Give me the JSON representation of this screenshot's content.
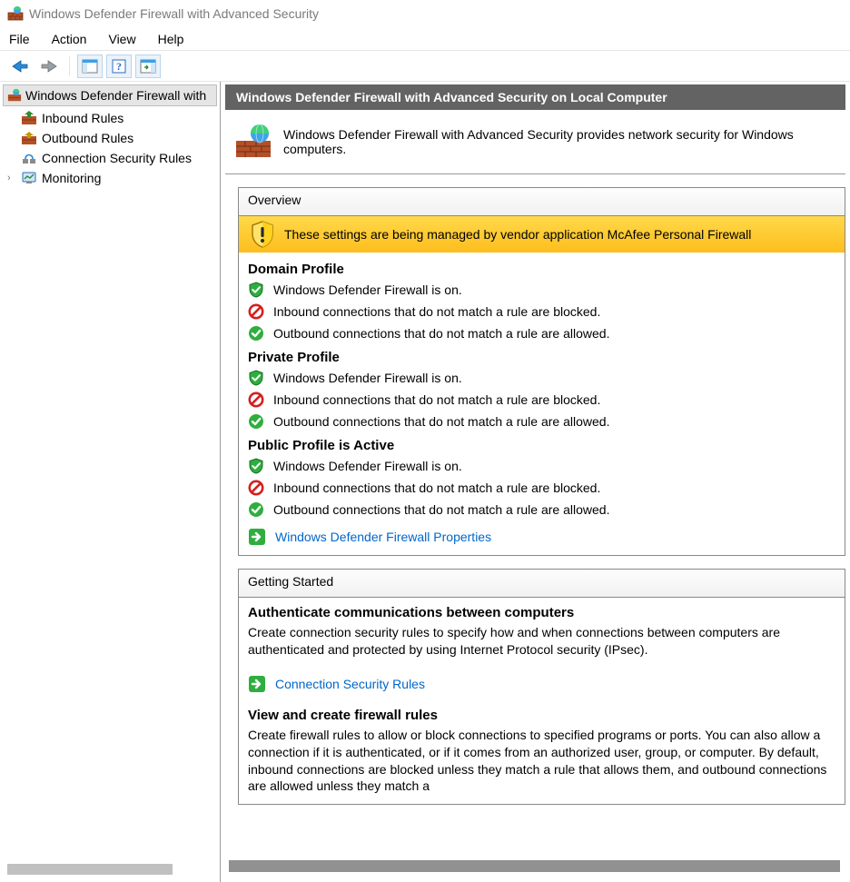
{
  "title": "Windows Defender Firewall with Advanced Security",
  "menu": [
    "File",
    "Action",
    "View",
    "Help"
  ],
  "tree": {
    "root": "Windows Defender Firewall with",
    "items": [
      {
        "label": "Inbound Rules"
      },
      {
        "label": "Outbound Rules"
      },
      {
        "label": "Connection Security Rules"
      },
      {
        "label": "Monitoring"
      }
    ]
  },
  "content": {
    "heading": "Windows Defender Firewall with Advanced Security on Local Computer",
    "intro": "Windows Defender Firewall with Advanced Security provides network security for Windows computers.",
    "overview": {
      "title": "Overview",
      "warning": "These settings are being managed by vendor application McAfee  Personal Firewall",
      "profiles": [
        {
          "title": "Domain Profile",
          "lines": [
            {
              "icon": "shield-on",
              "text": "Windows Defender Firewall is on."
            },
            {
              "icon": "block",
              "text": "Inbound connections that do not match a rule are blocked."
            },
            {
              "icon": "allow",
              "text": "Outbound connections that do not match a rule are allowed."
            }
          ]
        },
        {
          "title": "Private Profile",
          "lines": [
            {
              "icon": "shield-on",
              "text": "Windows Defender Firewall is on."
            },
            {
              "icon": "block",
              "text": "Inbound connections that do not match a rule are blocked."
            },
            {
              "icon": "allow",
              "text": "Outbound connections that do not match a rule are allowed."
            }
          ]
        },
        {
          "title": "Public Profile is Active",
          "lines": [
            {
              "icon": "shield-on",
              "text": "Windows Defender Firewall is on."
            },
            {
              "icon": "block",
              "text": "Inbound connections that do not match a rule are blocked."
            },
            {
              "icon": "allow",
              "text": "Outbound connections that do not match a rule are allowed."
            }
          ]
        }
      ],
      "properties_link": "Windows Defender Firewall Properties"
    },
    "getting_started": {
      "title": "Getting Started",
      "sections": [
        {
          "heading": "Authenticate communications between computers",
          "text": "Create connection security rules to specify how and when connections between computers are authenticated and protected by using Internet Protocol security (IPsec).",
          "link": "Connection Security Rules"
        },
        {
          "heading": "View and create firewall rules",
          "text": "Create firewall rules to allow or block connections to specified programs or ports. You can also allow a connection if it is authenticated, or if it comes from an authorized user, group, or computer. By default, inbound connections are blocked unless they match a rule that allows them, and outbound connections are allowed unless they match a"
        }
      ]
    }
  }
}
